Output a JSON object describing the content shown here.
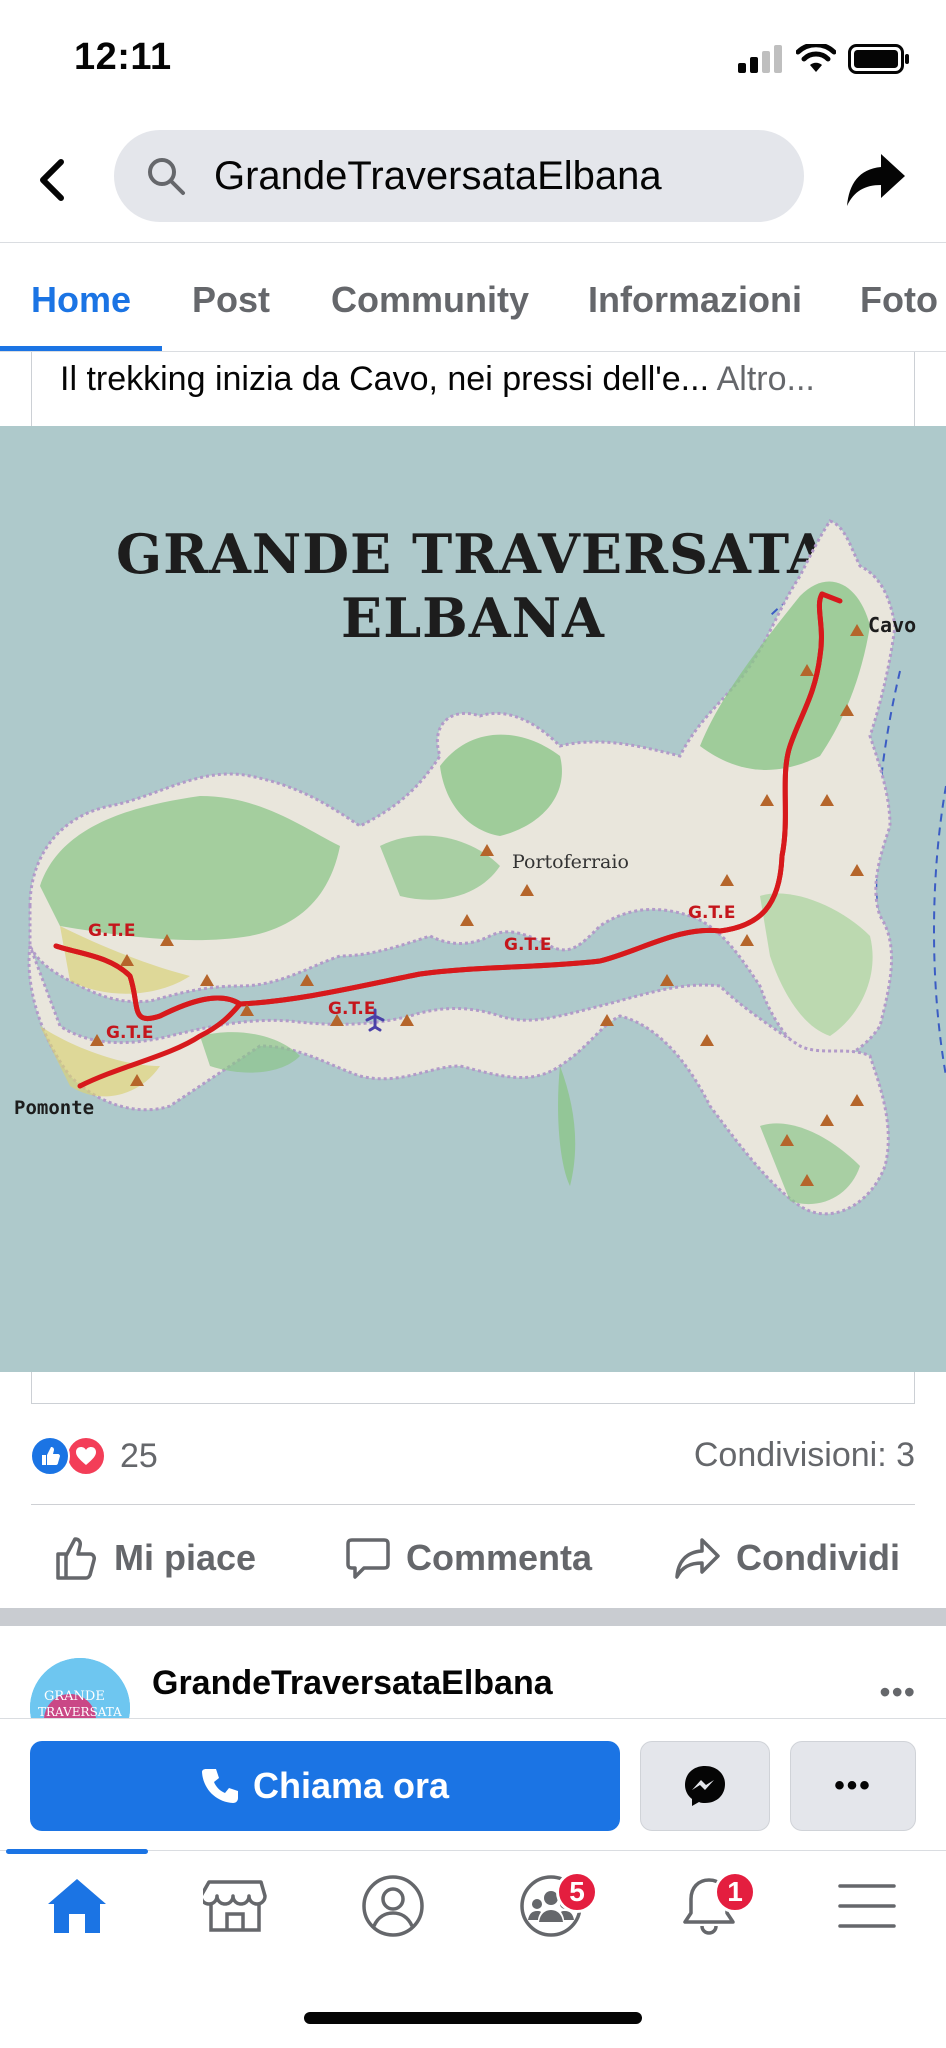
{
  "status_bar": {
    "time": "12:11"
  },
  "nav": {
    "search_text": "GrandeTraversataElbana",
    "back_icon": "chevron-left-icon",
    "share_icon": "share-arrow-icon"
  },
  "tabs": [
    {
      "label": "Home",
      "active": true
    },
    {
      "label": "Post",
      "active": false
    },
    {
      "label": "Community",
      "active": false
    },
    {
      "label": "Informazioni",
      "active": false
    },
    {
      "label": "Foto",
      "active": false
    }
  ],
  "post": {
    "caption": "Il trekking inizia da Cavo, nei pressi dell'e...",
    "more_label": " Altro...",
    "map": {
      "title": "GRANDE TRAVERSATA ELBANA",
      "labels": {
        "cavo": "Cavo",
        "portoferraio": "Portoferraio",
        "pomonte": "Pomonte",
        "gte": "G.T.E"
      }
    },
    "reactions_count": "25",
    "shares": "Condivisioni: 3",
    "actions": {
      "like": "Mi piace",
      "comment": "Commenta",
      "share": "Condividi"
    }
  },
  "next_post": {
    "author": "GrandeTraversataElbana",
    "more": "•••"
  },
  "cta": {
    "call_label": "Chiama ora",
    "more_label": "•••"
  },
  "bottom_nav": {
    "groups_badge": "5",
    "notifications_badge": "1"
  },
  "colors": {
    "accent": "#1b74e4",
    "badge": "#e41e3f",
    "route": "#d7191c",
    "sea": "#aec9cb",
    "land": "#e9e6dc",
    "forest": "#8cc58a"
  }
}
